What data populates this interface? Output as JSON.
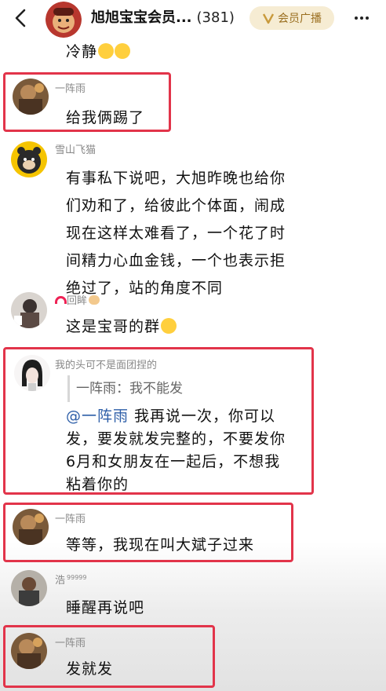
{
  "header": {
    "title": "旭旭宝宝会员...",
    "count": "(381)",
    "vip_badge": "会员广播"
  },
  "messages": [
    {
      "id": "m0",
      "text": "冷静"
    },
    {
      "id": "m1",
      "sender": "一阵雨",
      "text": "给我俩踢了"
    },
    {
      "id": "m2",
      "sender": "雪山飞猫",
      "lines": [
        "有事私下说吧，大旭昨晚也给你",
        "们劝和了，给彼此个体面，闹成",
        "现在这样太难看了，一个花了时",
        "间精力心血金钱，一个也表示拒",
        "绝过了，站的角度不同"
      ]
    },
    {
      "id": "m3",
      "sender": "回眸",
      "text": "这是宝哥的群"
    },
    {
      "id": "m4",
      "sender": "我的头可不是面团捏的",
      "quote": "一阵雨：我不能发",
      "mention": "@一阵雨",
      "lines": [
        " 我再说一次，你可以",
        "发，要发就发完整的，不要发你",
        "6月和女朋友在一起后，不想我",
        "粘着你的"
      ]
    },
    {
      "id": "m5",
      "sender": "一阵雨",
      "text": "等等，我现在叫大斌子过来"
    },
    {
      "id": "m6",
      "sender": "浩",
      "sender_suffix": "99999",
      "text": "睡醒再说吧"
    },
    {
      "id": "m7",
      "sender": "一阵雨",
      "text": "发就发"
    }
  ],
  "colors": {
    "highlight_border": "#e2344a",
    "mention": "#2d5ea8",
    "vip_badge_bg": "#f6ecd3",
    "vip_badge_text": "#9a6e1f"
  },
  "icons": {
    "back": "chevron-left-icon",
    "vip": "v-badge-icon",
    "more": "more-dots-icon",
    "emoji_laugh": "laugh-cry-emoji",
    "emoji_smirk": "unamused-emoji",
    "rainbow": "rainbow-emoji",
    "hand": "hand-emoji"
  }
}
